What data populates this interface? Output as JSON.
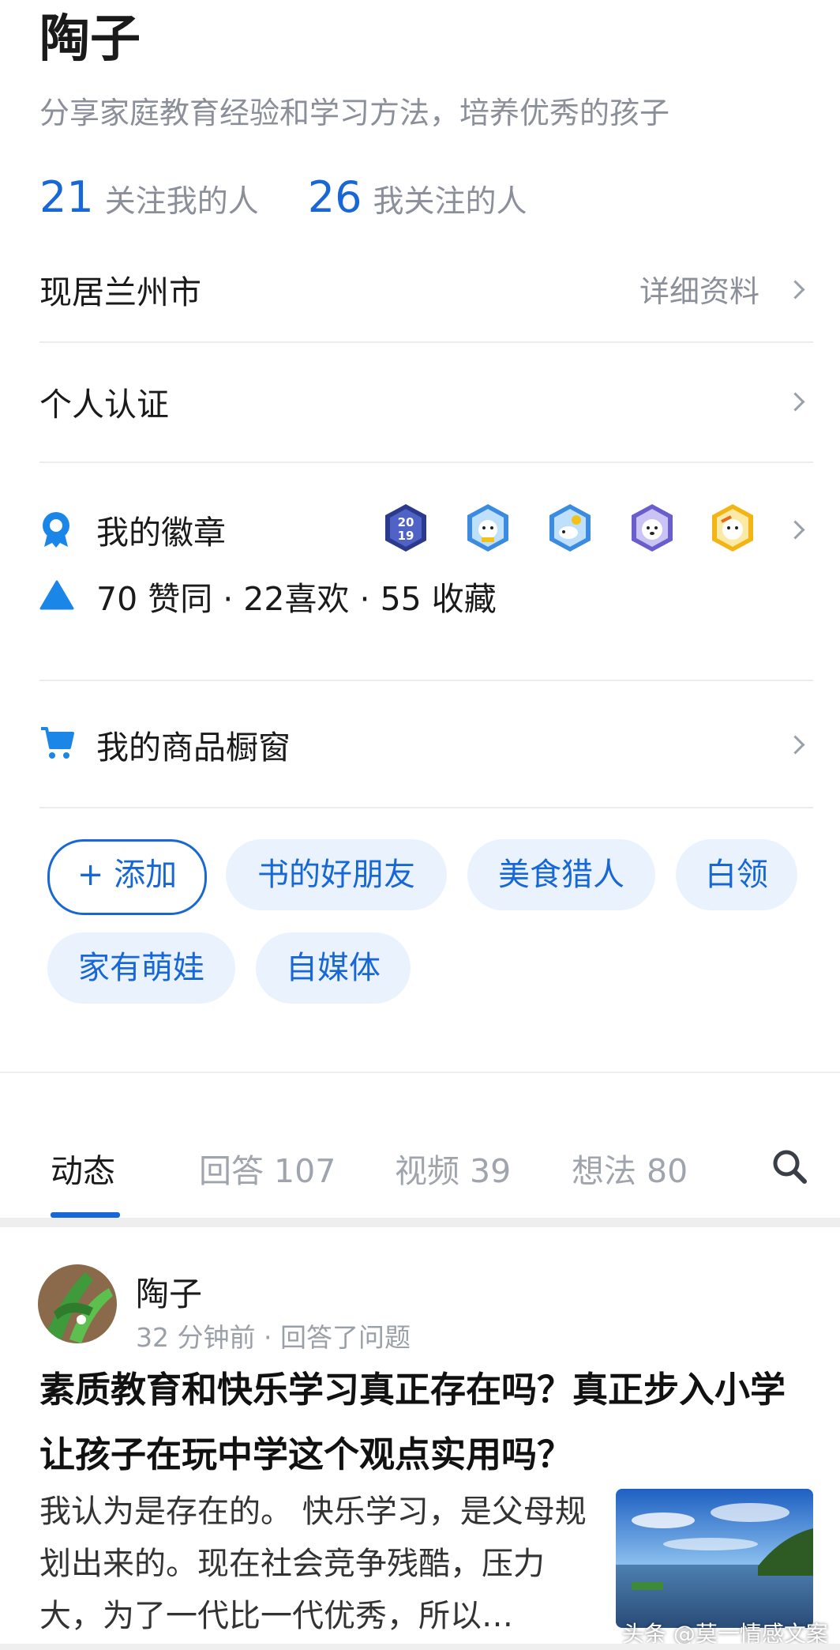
{
  "profile": {
    "name": "陶子",
    "bio": "分享家庭教育经验和学习方法，培养优秀的孩子",
    "followers_count": "21",
    "followers_label": "关注我的人",
    "following_count": "26",
    "following_label": "我关注的人"
  },
  "location": {
    "text": "现居兰州市",
    "detail_link": "详细资料"
  },
  "verification": {
    "label": "个人认证"
  },
  "badges": {
    "label": "我的徽章",
    "items": [
      "2019",
      "dog-badge",
      "sheep-badge",
      "dog-badge",
      "dog-badge"
    ],
    "stats": "70 赞同 · 22喜欢 · 55 收藏"
  },
  "shop": {
    "label": "我的商品橱窗"
  },
  "tags": {
    "add_label": "+ 添加",
    "items": [
      "书的好朋友",
      "美食猎人",
      "白领",
      "家有萌娃",
      "自媒体"
    ]
  },
  "tabs": [
    {
      "label": "动态"
    },
    {
      "label": "回答 107"
    },
    {
      "label": "视频 39"
    },
    {
      "label": "想法 80"
    }
  ],
  "feed": {
    "author": "陶子",
    "meta": "32 分钟前 · 回答了问题",
    "question": "素质教育和快乐学习真正存在吗？真正步入小学让孩子在玩中学这个观点实用吗？",
    "excerpt": "我认为是存在的。 快乐学习，是父母规划出来的。现在社会竞争残酷，压力大，为了一代比一代优秀，所以…",
    "watermark": "头条 @莫一情感文案"
  },
  "colors": {
    "accent": "#1867d6",
    "tag_bg": "#eaf3fd",
    "muted": "#8a8f99"
  }
}
